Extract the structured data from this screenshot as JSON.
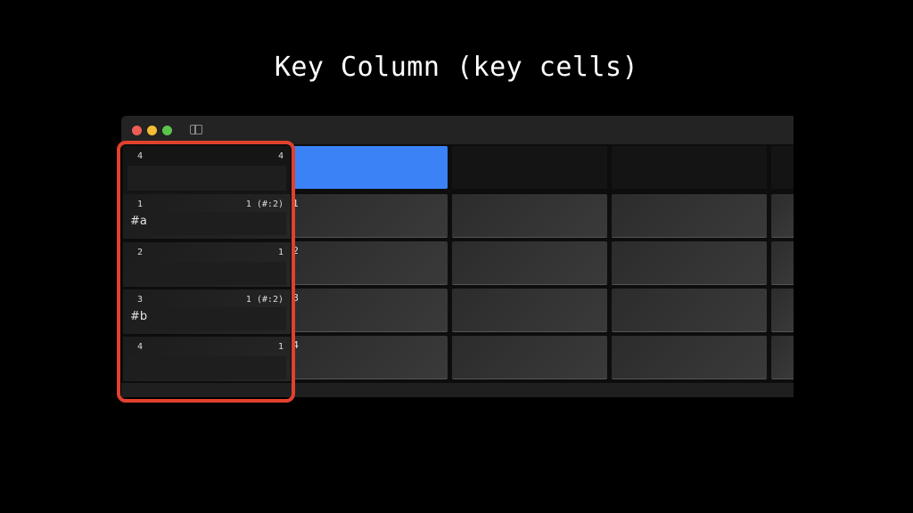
{
  "slide": {
    "title": "Key Column (key cells)"
  },
  "window": {
    "controls": [
      "close",
      "minimize",
      "zoom"
    ],
    "toolbar_icon": "sidebar-toggle-icon"
  },
  "key_column": {
    "header": {
      "index": "4",
      "count": "4",
      "value": ""
    },
    "rows": [
      {
        "index": "1",
        "count": "1 (#:2)",
        "value": "#a"
      },
      {
        "index": "2",
        "count": "1",
        "value": ""
      },
      {
        "index": "3",
        "count": "1 (#:2)",
        "value": "#b"
      },
      {
        "index": "4",
        "count": "1",
        "value": ""
      }
    ]
  },
  "data_rows": {
    "labels": [
      "1",
      "2",
      "3",
      "4"
    ]
  },
  "colors": {
    "selected_header": "#3b82f6",
    "highlight": "#e2412e",
    "close": "#ee5d55",
    "minimize": "#f3bd35",
    "zoom": "#5cc44b"
  }
}
